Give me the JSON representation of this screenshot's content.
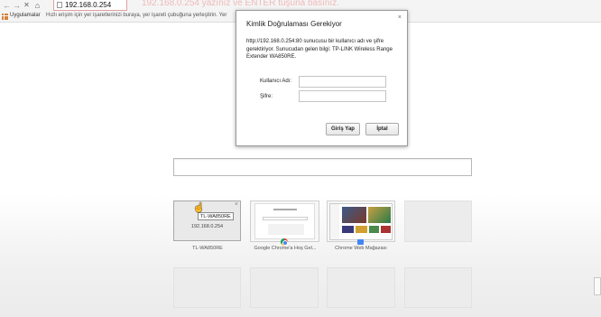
{
  "toolbar": {
    "back_icon": "back-arrow-icon",
    "forward_icon": "forward-arrow-icon",
    "stop_icon": "stop-icon",
    "home_icon": "home-icon",
    "address": "192.168.0.254",
    "overlay_hint": "192.168.0.254 yazınız ve ENTER tuşuna basınız."
  },
  "bookmarks": {
    "apps_label": "Uygulamalar",
    "hint": "Hızlı erişim için yer işaretlerinizi buraya, yer işareti çubuğuna yerleştirin. Yer"
  },
  "dialog": {
    "title": "Kimlik Doğrulaması Gerekiyor",
    "close_icon": "×",
    "message": "http://192.168.0.254:80 sunucusu bir kullanıcı adı ve şifre gerektiriyor. Sunucudan gelen bilgi: TP-LINK Wireless Range Extender WA850RE.",
    "username_label": "Kullanıcı Adı:",
    "username_value": "",
    "password_label": "Şifre:",
    "password_value": "",
    "login_button": "Giriş Yap",
    "cancel_button": "İptal"
  },
  "search": {
    "value": ""
  },
  "tiles": [
    {
      "label": "TL-WA850RE",
      "thumb_text": "192.168.0.254",
      "tooltip": "TL-WA850RE",
      "close_icon": "×"
    },
    {
      "label": "Google Chrome'a Hoş Gel..."
    },
    {
      "label": "Chrome Web Mağazası"
    }
  ],
  "colors": {
    "accent_link": "#4285f4",
    "address_border": "#e0a0a0"
  }
}
